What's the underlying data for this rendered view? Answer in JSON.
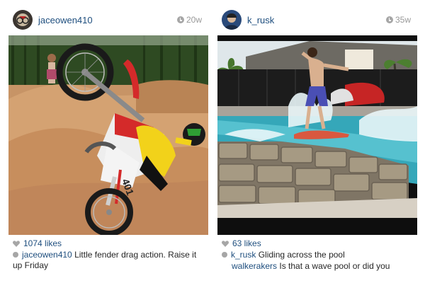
{
  "posts": [
    {
      "username": "jaceowen410",
      "time": "20w",
      "likes": "1074 likes",
      "caption_user": "jaceowen410",
      "caption_text": "Little fender drag action. Raise it up Friday",
      "bike_number": "401"
    },
    {
      "username": "k_rusk",
      "time": "35w",
      "likes": "63 likes",
      "caption_user": "k_rusk",
      "caption_text": "Gliding across the pool",
      "comment_user": "walkerakers",
      "comment_text": "Is that a wave pool or did you"
    }
  ],
  "icons": {
    "time": "clock-icon",
    "likes": "heart-icon",
    "comment": "comment-bubble-icon"
  },
  "colors": {
    "username": "#1e4e7e",
    "meta": "#999999",
    "icon": "#a6a6a6"
  }
}
